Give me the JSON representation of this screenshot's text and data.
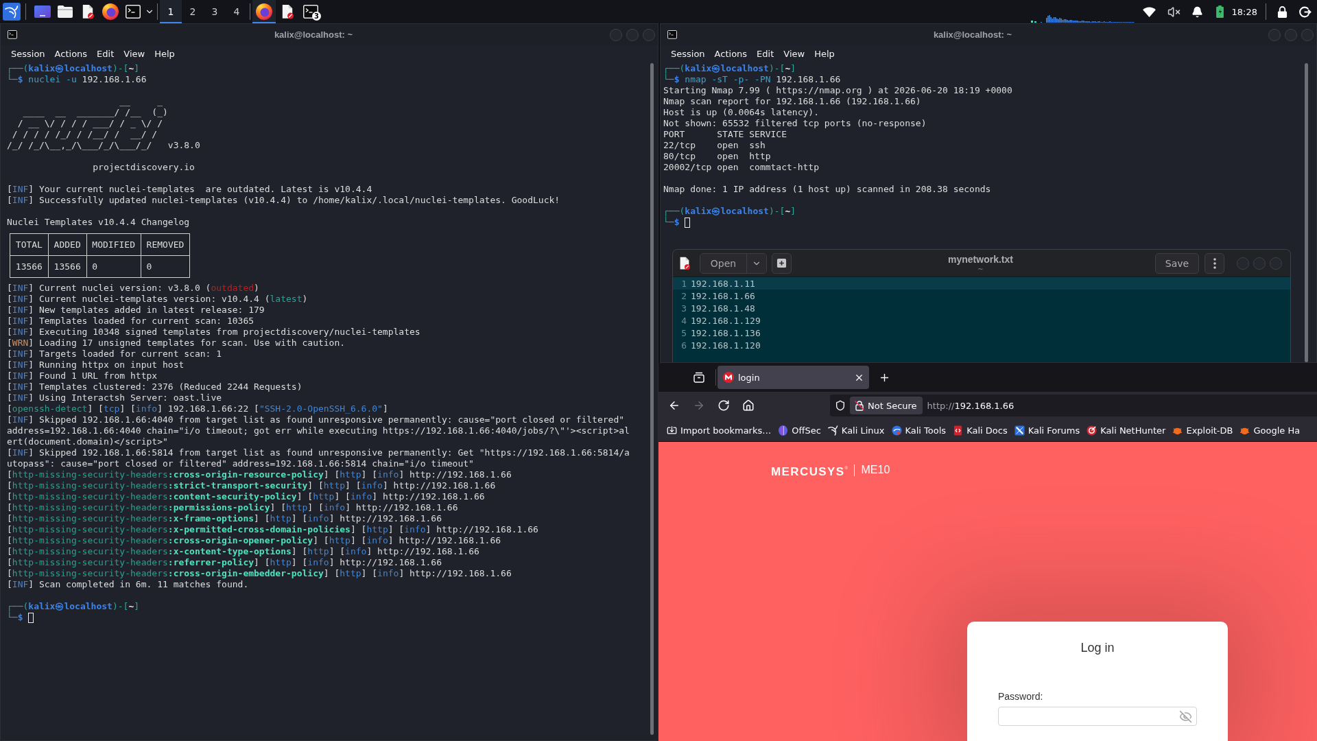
{
  "taskbar": {
    "workspaces": [
      {
        "label": "1",
        "selected": true
      },
      {
        "label": "2",
        "selected": false
      },
      {
        "label": "3",
        "selected": false
      },
      {
        "label": "4",
        "selected": false
      }
    ],
    "windows": [
      {
        "kind": "browser",
        "selected": true
      },
      {
        "kind": "editor",
        "selected": false
      },
      {
        "kind": "terminal",
        "selected": false,
        "count": "3"
      }
    ],
    "muted": true,
    "clock": "18:28"
  },
  "terminals": [
    {
      "title": "kalix@localhost: ~",
      "menu": [
        "Session",
        "Actions",
        "Edit",
        "View",
        "Help"
      ],
      "paragraphs": [
        [
          {
            "kind": "text",
            "parts": [
              {
                "kind": "frame",
                "text": "┌──("
              },
              {
                "kind": "host",
                "text": "kalix㉿localhost"
              },
              {
                "kind": "frame",
                "text": ")-["
              },
              {
                "kind": "path",
                "text": "~"
              },
              {
                "kind": "frame",
                "text": "]"
              }
            ]
          },
          {
            "kind": "text",
            "parts": [
              {
                "kind": "frame",
                "text": "└─"
              },
              {
                "kind": "sign",
                "text": "$"
              },
              {
                "kind": "command",
                "text": " nuclei -u"
              },
              {
                "kind": "plain",
                "text": " 192.168.1.66"
              }
            ]
          }
        ],
        [
          {
            "kind": "text",
            "parts": [
              {
                "kind": "plain",
                "text": "                     __     _"
              }
            ]
          },
          {
            "kind": "text",
            "parts": [
              {
                "kind": "plain",
                "text": "   ____  __  _______/ /__  (_)"
              }
            ]
          },
          {
            "kind": "text",
            "parts": [
              {
                "kind": "plain",
                "text": "  / __ \\/ / / / ___/ / _ \\/ /"
              }
            ]
          },
          {
            "kind": "text",
            "parts": [
              {
                "kind": "plain",
                "text": " / / / / /_/ / /__/ /  __/ /"
              }
            ]
          },
          {
            "kind": "text",
            "parts": [
              {
                "kind": "plain",
                "text": "/_/ /_/\\__,_/\\___/_/\\___/_/   v3.8.0"
              }
            ]
          }
        ],
        [
          {
            "kind": "text",
            "parts": [
              {
                "kind": "plain",
                "text": "                projectdiscovery.io"
              }
            ]
          }
        ],
        [
          {
            "kind": "text",
            "parts": [
              {
                "kind": "plain",
                "text": "["
              },
              {
                "kind": "tag",
                "text": "INF"
              },
              {
                "kind": "plain",
                "text": "] Your current nuclei-templates  are outdated. Latest is v10.4.4"
              }
            ]
          },
          {
            "kind": "text",
            "parts": [
              {
                "kind": "plain",
                "text": "["
              },
              {
                "kind": "tag",
                "text": "INF"
              },
              {
                "kind": "plain",
                "text": "] Successfully updated nuclei-templates (v10.4.4) to /home/kalix/.local/nuclei-templates. GoodLuck!"
              }
            ]
          }
        ],
        [
          {
            "kind": "text",
            "parts": [
              {
                "kind": "plain",
                "text": "Nuclei Templates v10.4.4 Changelog"
              }
            ]
          },
          {
            "kind": "table",
            "columns": [
              "TOTAL",
              "ADDED",
              "MODIFIED",
              "REMOVED"
            ],
            "rows": [
              [
                "13566",
                "13566",
                "0",
                "0"
              ]
            ]
          },
          {
            "kind": "text",
            "parts": [
              {
                "kind": "plain",
                "text": "["
              },
              {
                "kind": "tag",
                "text": "INF"
              },
              {
                "kind": "plain",
                "text": "] Current nuclei version: v3.8.0 ("
              },
              {
                "kind": "alert",
                "text": "outdated"
              },
              {
                "kind": "plain",
                "text": ")"
              }
            ]
          },
          {
            "kind": "text",
            "parts": [
              {
                "kind": "plain",
                "text": "["
              },
              {
                "kind": "tag",
                "text": "INF"
              },
              {
                "kind": "plain",
                "text": "] Current nuclei-templates version: v10.4.4 ("
              },
              {
                "kind": "ok",
                "text": "latest"
              },
              {
                "kind": "plain",
                "text": ")"
              }
            ]
          },
          {
            "kind": "text",
            "parts": [
              {
                "kind": "plain",
                "text": "["
              },
              {
                "kind": "tag",
                "text": "INF"
              },
              {
                "kind": "plain",
                "text": "] New templates added in latest release: 179"
              }
            ]
          },
          {
            "kind": "text",
            "parts": [
              {
                "kind": "plain",
                "text": "["
              },
              {
                "kind": "tag",
                "text": "INF"
              },
              {
                "kind": "plain",
                "text": "] Templates loaded for current scan: 10365"
              }
            ]
          },
          {
            "kind": "text",
            "parts": [
              {
                "kind": "plain",
                "text": "["
              },
              {
                "kind": "tag",
                "text": "INF"
              },
              {
                "kind": "plain",
                "text": "] Executing 10348 signed templates from projectdiscovery/nuclei-templates"
              }
            ]
          },
          {
            "kind": "text",
            "parts": [
              {
                "kind": "plain",
                "text": "["
              },
              {
                "kind": "warning",
                "text": "WRN"
              },
              {
                "kind": "plain",
                "text": "] Loading 17 unsigned templates for scan. Use with caution."
              }
            ]
          },
          {
            "kind": "text",
            "parts": [
              {
                "kind": "plain",
                "text": "["
              },
              {
                "kind": "tag",
                "text": "INF"
              },
              {
                "kind": "plain",
                "text": "] Targets loaded for current scan: 1"
              }
            ]
          },
          {
            "kind": "text",
            "parts": [
              {
                "kind": "plain",
                "text": "["
              },
              {
                "kind": "tag",
                "text": "INF"
              },
              {
                "kind": "plain",
                "text": "] Running httpx on input host"
              }
            ]
          },
          {
            "kind": "text",
            "parts": [
              {
                "kind": "plain",
                "text": "["
              },
              {
                "kind": "tag",
                "text": "INF"
              },
              {
                "kind": "plain",
                "text": "] Found 1 URL from httpx"
              }
            ]
          },
          {
            "kind": "text",
            "parts": [
              {
                "kind": "plain",
                "text": "["
              },
              {
                "kind": "tag",
                "text": "INF"
              },
              {
                "kind": "plain",
                "text": "] Templates clustered: 2376 (Reduced 2244 Requests)"
              }
            ]
          },
          {
            "kind": "text",
            "parts": [
              {
                "kind": "plain",
                "text": "["
              },
              {
                "kind": "tag",
                "text": "INF"
              },
              {
                "kind": "plain",
                "text": "] Using Interactsh Server: oast.live"
              }
            ]
          },
          {
            "kind": "text",
            "parts": [
              {
                "kind": "plain",
                "text": "["
              },
              {
                "kind": "template",
                "text": "openssh-detect"
              },
              {
                "kind": "plain",
                "text": "] ["
              },
              {
                "kind": "tag",
                "text": "tcp"
              },
              {
                "kind": "plain",
                "text": "] ["
              },
              {
                "kind": "tag",
                "text": "info"
              },
              {
                "kind": "plain",
                "text": "] 192.168.1.66:22 ["
              },
              {
                "kind": "tag",
                "text": "\"SSH-2.0-OpenSSH_6.6.0\""
              },
              {
                "kind": "plain",
                "text": "]"
              }
            ]
          },
          {
            "kind": "text",
            "parts": [
              {
                "kind": "plain",
                "text": "["
              },
              {
                "kind": "tag",
                "text": "INF"
              },
              {
                "kind": "plain",
                "text": "] Skipped 192.168.1.66:4040 from target list as found unresponsive permanently: cause=\"port closed or filtered\""
              }
            ]
          },
          {
            "kind": "text",
            "parts": [
              {
                "kind": "plain",
                "text": "address=192.168.1.66:4040 chain=\"i/o timeout; got err while executing https://192.168.1.66:4040/jobs/?\\\"'><script>al"
              }
            ]
          },
          {
            "kind": "text",
            "parts": [
              {
                "kind": "plain",
                "text": "ert(document.domain)</script>\""
              }
            ]
          },
          {
            "kind": "text",
            "parts": [
              {
                "kind": "plain",
                "text": "["
              },
              {
                "kind": "tag",
                "text": "INF"
              },
              {
                "kind": "plain",
                "text": "] Skipped 192.168.1.66:5814 from target list as found unresponsive permanently: Get \"https://192.168.1.66:5814/a"
              }
            ]
          },
          {
            "kind": "text",
            "parts": [
              {
                "kind": "plain",
                "text": "utopass\": cause=\"port closed or filtered\" address=192.168.1.66:5814 chain=\"i/o timeout\""
              }
            ]
          },
          {
            "kind": "text",
            "parts": [
              {
                "kind": "plain",
                "text": "["
              },
              {
                "kind": "template",
                "text": "http-missing-security-headers"
              },
              {
                "kind": "matcher",
                "text": ":cross-origin-resource-policy"
              },
              {
                "kind": "plain",
                "text": "] ["
              },
              {
                "kind": "tag",
                "text": "http"
              },
              {
                "kind": "plain",
                "text": "] ["
              },
              {
                "kind": "tag",
                "text": "info"
              },
              {
                "kind": "plain",
                "text": "] http://192.168.1.66"
              }
            ]
          },
          {
            "kind": "text",
            "parts": [
              {
                "kind": "plain",
                "text": "["
              },
              {
                "kind": "template",
                "text": "http-missing-security-headers"
              },
              {
                "kind": "matcher",
                "text": ":strict-transport-security"
              },
              {
                "kind": "plain",
                "text": "] ["
              },
              {
                "kind": "tag",
                "text": "http"
              },
              {
                "kind": "plain",
                "text": "] ["
              },
              {
                "kind": "tag",
                "text": "info"
              },
              {
                "kind": "plain",
                "text": "] http://192.168.1.66"
              }
            ]
          },
          {
            "kind": "text",
            "parts": [
              {
                "kind": "plain",
                "text": "["
              },
              {
                "kind": "template",
                "text": "http-missing-security-headers"
              },
              {
                "kind": "matcher",
                "text": ":content-security-policy"
              },
              {
                "kind": "plain",
                "text": "] ["
              },
              {
                "kind": "tag",
                "text": "http"
              },
              {
                "kind": "plain",
                "text": "] ["
              },
              {
                "kind": "tag",
                "text": "info"
              },
              {
                "kind": "plain",
                "text": "] http://192.168.1.66"
              }
            ]
          },
          {
            "kind": "text",
            "parts": [
              {
                "kind": "plain",
                "text": "["
              },
              {
                "kind": "template",
                "text": "http-missing-security-headers"
              },
              {
                "kind": "matcher",
                "text": ":permissions-policy"
              },
              {
                "kind": "plain",
                "text": "] ["
              },
              {
                "kind": "tag",
                "text": "http"
              },
              {
                "kind": "plain",
                "text": "] ["
              },
              {
                "kind": "tag",
                "text": "info"
              },
              {
                "kind": "plain",
                "text": "] http://192.168.1.66"
              }
            ]
          },
          {
            "kind": "text",
            "parts": [
              {
                "kind": "plain",
                "text": "["
              },
              {
                "kind": "template",
                "text": "http-missing-security-headers"
              },
              {
                "kind": "matcher",
                "text": ":x-frame-options"
              },
              {
                "kind": "plain",
                "text": "] ["
              },
              {
                "kind": "tag",
                "text": "http"
              },
              {
                "kind": "plain",
                "text": "] ["
              },
              {
                "kind": "tag",
                "text": "info"
              },
              {
                "kind": "plain",
                "text": "] http://192.168.1.66"
              }
            ]
          },
          {
            "kind": "text",
            "parts": [
              {
                "kind": "plain",
                "text": "["
              },
              {
                "kind": "template",
                "text": "http-missing-security-headers"
              },
              {
                "kind": "matcher",
                "text": ":x-permitted-cross-domain-policies"
              },
              {
                "kind": "plain",
                "text": "] ["
              },
              {
                "kind": "tag",
                "text": "http"
              },
              {
                "kind": "plain",
                "text": "] ["
              },
              {
                "kind": "tag",
                "text": "info"
              },
              {
                "kind": "plain",
                "text": "] http://192.168.1.66"
              }
            ]
          },
          {
            "kind": "text",
            "parts": [
              {
                "kind": "plain",
                "text": "["
              },
              {
                "kind": "template",
                "text": "http-missing-security-headers"
              },
              {
                "kind": "matcher",
                "text": ":cross-origin-opener-policy"
              },
              {
                "kind": "plain",
                "text": "] ["
              },
              {
                "kind": "tag",
                "text": "http"
              },
              {
                "kind": "plain",
                "text": "] ["
              },
              {
                "kind": "tag",
                "text": "info"
              },
              {
                "kind": "plain",
                "text": "] http://192.168.1.66"
              }
            ]
          },
          {
            "kind": "text",
            "parts": [
              {
                "kind": "plain",
                "text": "["
              },
              {
                "kind": "template",
                "text": "http-missing-security-headers"
              },
              {
                "kind": "matcher",
                "text": ":x-content-type-options"
              },
              {
                "kind": "plain",
                "text": "] ["
              },
              {
                "kind": "tag",
                "text": "http"
              },
              {
                "kind": "plain",
                "text": "] ["
              },
              {
                "kind": "tag",
                "text": "info"
              },
              {
                "kind": "plain",
                "text": "] http://192.168.1.66"
              }
            ]
          },
          {
            "kind": "text",
            "parts": [
              {
                "kind": "plain",
                "text": "["
              },
              {
                "kind": "template",
                "text": "http-missing-security-headers"
              },
              {
                "kind": "matcher",
                "text": ":referrer-policy"
              },
              {
                "kind": "plain",
                "text": "] ["
              },
              {
                "kind": "tag",
                "text": "http"
              },
              {
                "kind": "plain",
                "text": "] ["
              },
              {
                "kind": "tag",
                "text": "info"
              },
              {
                "kind": "plain",
                "text": "] http://192.168.1.66"
              }
            ]
          },
          {
            "kind": "text",
            "parts": [
              {
                "kind": "plain",
                "text": "["
              },
              {
                "kind": "template",
                "text": "http-missing-security-headers"
              },
              {
                "kind": "matcher",
                "text": ":cross-origin-embedder-policy"
              },
              {
                "kind": "plain",
                "text": "] ["
              },
              {
                "kind": "tag",
                "text": "http"
              },
              {
                "kind": "plain",
                "text": "] ["
              },
              {
                "kind": "tag",
                "text": "info"
              },
              {
                "kind": "plain",
                "text": "] http://192.168.1.66"
              }
            ]
          },
          {
            "kind": "text",
            "parts": [
              {
                "kind": "plain",
                "text": "["
              },
              {
                "kind": "tag",
                "text": "INF"
              },
              {
                "kind": "plain",
                "text": "] Scan completed in 6m. 11 matches found."
              }
            ]
          }
        ],
        [
          {
            "kind": "text",
            "parts": [
              {
                "kind": "frame",
                "text": "┌──("
              },
              {
                "kind": "host",
                "text": "kalix㉿localhost"
              },
              {
                "kind": "frame",
                "text": ")-["
              },
              {
                "kind": "path",
                "text": "~"
              },
              {
                "kind": "frame",
                "text": "]"
              }
            ]
          },
          {
            "kind": "input",
            "parts": [
              {
                "kind": "frame",
                "text": "└─"
              },
              {
                "kind": "sign",
                "text": "$"
              }
            ],
            "cursor": true
          }
        ]
      ]
    },
    {
      "title": "kalix@localhost: ~",
      "menu": [
        "Session",
        "Actions",
        "Edit",
        "View",
        "Help"
      ],
      "paragraphs": [
        [
          {
            "kind": "text",
            "parts": [
              {
                "kind": "frame",
                "text": "┌──("
              },
              {
                "kind": "host",
                "text": "kalix㉿localhost"
              },
              {
                "kind": "frame",
                "text": ")-["
              },
              {
                "kind": "path",
                "text": "~"
              },
              {
                "kind": "frame",
                "text": "]"
              }
            ]
          },
          {
            "kind": "text",
            "parts": [
              {
                "kind": "frame",
                "text": "└─"
              },
              {
                "kind": "sign",
                "text": "$"
              },
              {
                "kind": "command",
                "text": " nmap -sT -p- -PN"
              },
              {
                "kind": "plain",
                "text": " 192.168.1.66"
              }
            ]
          },
          {
            "kind": "text",
            "parts": [
              {
                "kind": "plain",
                "text": "Starting Nmap 7.99 ( https://nmap.org ) at 2026-06-20 18:19 +0000"
              }
            ]
          },
          {
            "kind": "text",
            "parts": [
              {
                "kind": "plain",
                "text": "Nmap scan report for 192.168.1.66 (192.168.1.66)"
              }
            ]
          },
          {
            "kind": "text",
            "parts": [
              {
                "kind": "plain",
                "text": "Host is up (0.0064s latency)."
              }
            ]
          },
          {
            "kind": "text",
            "parts": [
              {
                "kind": "plain",
                "text": "Not shown: 65532 filtered tcp ports (no-response)"
              }
            ]
          },
          {
            "kind": "text",
            "parts": [
              {
                "kind": "plain",
                "text": "PORT      STATE SERVICE"
              }
            ]
          },
          {
            "kind": "text",
            "parts": [
              {
                "kind": "plain",
                "text": "22/tcp    open  ssh"
              }
            ]
          },
          {
            "kind": "text",
            "parts": [
              {
                "kind": "plain",
                "text": "80/tcp    open  http"
              }
            ]
          },
          {
            "kind": "text",
            "parts": [
              {
                "kind": "plain",
                "text": "20002/tcp open  commtact-http"
              }
            ]
          }
        ],
        [
          {
            "kind": "text",
            "parts": [
              {
                "kind": "plain",
                "text": "Nmap done: 1 IP address (1 host up) scanned in 208.38 seconds"
              }
            ]
          }
        ],
        [
          {
            "kind": "text",
            "parts": [
              {
                "kind": "frame",
                "text": "┌──("
              },
              {
                "kind": "host",
                "text": "kalix㉿localhost"
              },
              {
                "kind": "frame",
                "text": ")-["
              },
              {
                "kind": "path",
                "text": "~"
              },
              {
                "kind": "frame",
                "text": "]"
              }
            ]
          },
          {
            "kind": "input",
            "parts": [
              {
                "kind": "frame",
                "text": "└─"
              },
              {
                "kind": "sign",
                "text": "$"
              }
            ],
            "cursor": true
          }
        ]
      ]
    }
  ],
  "editor": {
    "title": "mynetwork.txt",
    "subtitle": "~",
    "open_label": "Open",
    "save_label": "Save",
    "lines": [
      {
        "number": "1",
        "text": "192.168.1.11",
        "current": true
      },
      {
        "number": "2",
        "text": "192.168.1.66",
        "current": false
      },
      {
        "number": "3",
        "text": "192.168.1.48",
        "current": false
      },
      {
        "number": "4",
        "text": "192.168.1.129",
        "current": false
      },
      {
        "number": "5",
        "text": "192.168.1.136",
        "current": false
      },
      {
        "number": "6",
        "text": "192.168.1.120",
        "current": false
      }
    ]
  },
  "browser": {
    "tabs": [
      {
        "title": "login",
        "selected": true
      }
    ],
    "nav": [
      {
        "kind": "back",
        "disabled": false
      },
      {
        "kind": "forward",
        "disabled": true
      },
      {
        "kind": "reload",
        "disabled": false
      },
      {
        "kind": "home",
        "disabled": false
      }
    ],
    "security_label": "Not Secure",
    "url": {
      "scheme": "http://",
      "host": "192.168.1.66"
    },
    "bookmarks": [
      {
        "kind": "import",
        "label": "Import bookmarks…"
      },
      {
        "kind": "orb",
        "label": "OffSec"
      },
      {
        "kind": "dragon",
        "label": "Kali Linux"
      },
      {
        "kind": "disc",
        "label": "Kali Tools"
      },
      {
        "kind": "book",
        "label": "Kali Docs"
      },
      {
        "kind": "pen",
        "label": "Kali Forums"
      },
      {
        "kind": "target",
        "label": "Kali NetHunter"
      },
      {
        "kind": "bug",
        "label": "Exploit-DB"
      },
      {
        "kind": "bug",
        "label": "Google Ha"
      }
    ],
    "page": {
      "brand": "MERCUSYS$^{®}$",
      "model": "ME10",
      "login": {
        "title": "Log in",
        "password_label": "Password:",
        "password_revealed": false
      }
    }
  }
}
